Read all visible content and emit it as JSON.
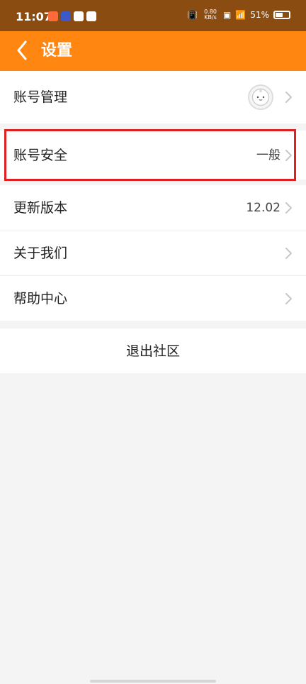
{
  "status_bar": {
    "time": "11:07",
    "network_speed_value": "0.80",
    "network_speed_unit": "KB/s",
    "battery": "51%"
  },
  "header": {
    "title": "设置"
  },
  "rows": [
    {
      "label": "账号管理",
      "value": ""
    },
    {
      "label": "账号安全",
      "value": "一般"
    },
    {
      "label": "更新版本",
      "value": "12.02"
    },
    {
      "label": "关于我们",
      "value": ""
    },
    {
      "label": "帮助中心",
      "value": ""
    }
  ],
  "logout": {
    "label": "退出社区"
  },
  "colors": {
    "status_bar": "#8b4c12",
    "app_bar": "#ff8610",
    "highlight": "#e02020",
    "background": "#f4f4f4"
  },
  "icons": {
    "back": "chevron-left-icon",
    "row_arrow": "chevron-right-icon",
    "avatar": "avatar-icon"
  }
}
